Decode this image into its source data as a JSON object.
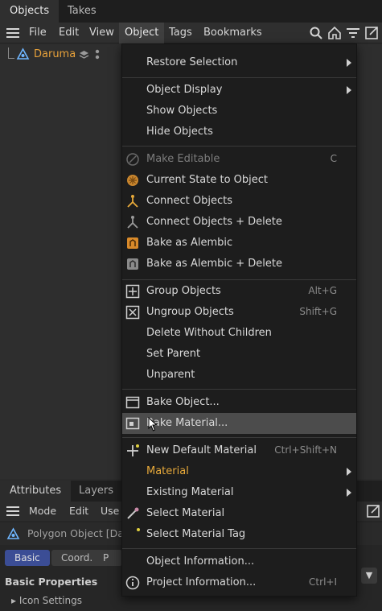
{
  "tabs": [
    "Objects",
    "Takes"
  ],
  "menubar": {
    "items": [
      "File",
      "Edit",
      "View",
      "Object",
      "Tags",
      "Bookmarks"
    ],
    "active_index": 3
  },
  "objects": [
    {
      "name": "Daruma",
      "color": "#e7a13a"
    }
  ],
  "context_menu": {
    "groups": [
      [
        {
          "label": "Restore Selection",
          "submenu": true
        }
      ],
      [
        {
          "label": "Object Display",
          "submenu": true
        },
        {
          "label": "Show Objects"
        },
        {
          "label": "Hide Objects"
        }
      ],
      [
        {
          "label": "Make Editable",
          "shortcut": "C",
          "disabled": true,
          "icon": "make-editable-icon"
        },
        {
          "label": "Current State to Object",
          "icon": "current-state-icon"
        },
        {
          "label": "Connect Objects",
          "icon": "connect-objects-icon"
        },
        {
          "label": "Connect Objects + Delete",
          "icon": "connect-objects-delete-icon"
        },
        {
          "label": "Bake as Alembic",
          "icon": "bake-alembic-icon"
        },
        {
          "label": "Bake as Alembic + Delete",
          "icon": "bake-alembic-delete-icon"
        }
      ],
      [
        {
          "label": "Group Objects",
          "shortcut": "Alt+G",
          "icon": "group-objects-icon"
        },
        {
          "label": "Ungroup Objects",
          "shortcut": "Shift+G",
          "icon": "ungroup-objects-icon"
        },
        {
          "label": "Delete Without Children"
        },
        {
          "label": "Set Parent"
        },
        {
          "label": "Unparent"
        }
      ],
      [
        {
          "label": "Bake Object...",
          "icon": "bake-object-icon"
        },
        {
          "label": "Bake Material...",
          "icon": "bake-material-icon",
          "highlighted": true
        }
      ],
      [
        {
          "label": "New Default Material",
          "shortcut": "Ctrl+Shift+N",
          "icon": "new-material-icon"
        },
        {
          "label": "Material",
          "submenu": true,
          "accent": true
        },
        {
          "label": "Existing Material",
          "submenu": true
        },
        {
          "label": "Select Material",
          "icon": "select-material-icon"
        },
        {
          "label": "Select Material Tag",
          "icon": "select-material-tag-icon"
        }
      ],
      [
        {
          "label": "Object Information..."
        },
        {
          "label": "Project Information...",
          "shortcut": "Ctrl+I",
          "icon": "info-icon"
        }
      ]
    ]
  },
  "attributes": {
    "tabs": [
      "Attributes",
      "Layers"
    ],
    "menubar": [
      "Mode",
      "Edit",
      "Use"
    ],
    "object_label": "Polygon Object [Dar",
    "buttons": [
      "Basic",
      "Coord.",
      "P"
    ],
    "section_title": "Basic Properties",
    "subsection": "Icon Settings"
  },
  "colors": {
    "accent": "#e7a93a",
    "highlight": "#4c4c4c",
    "menu_bg": "#1d1d1d",
    "basic_tab": "#3b4d95"
  }
}
